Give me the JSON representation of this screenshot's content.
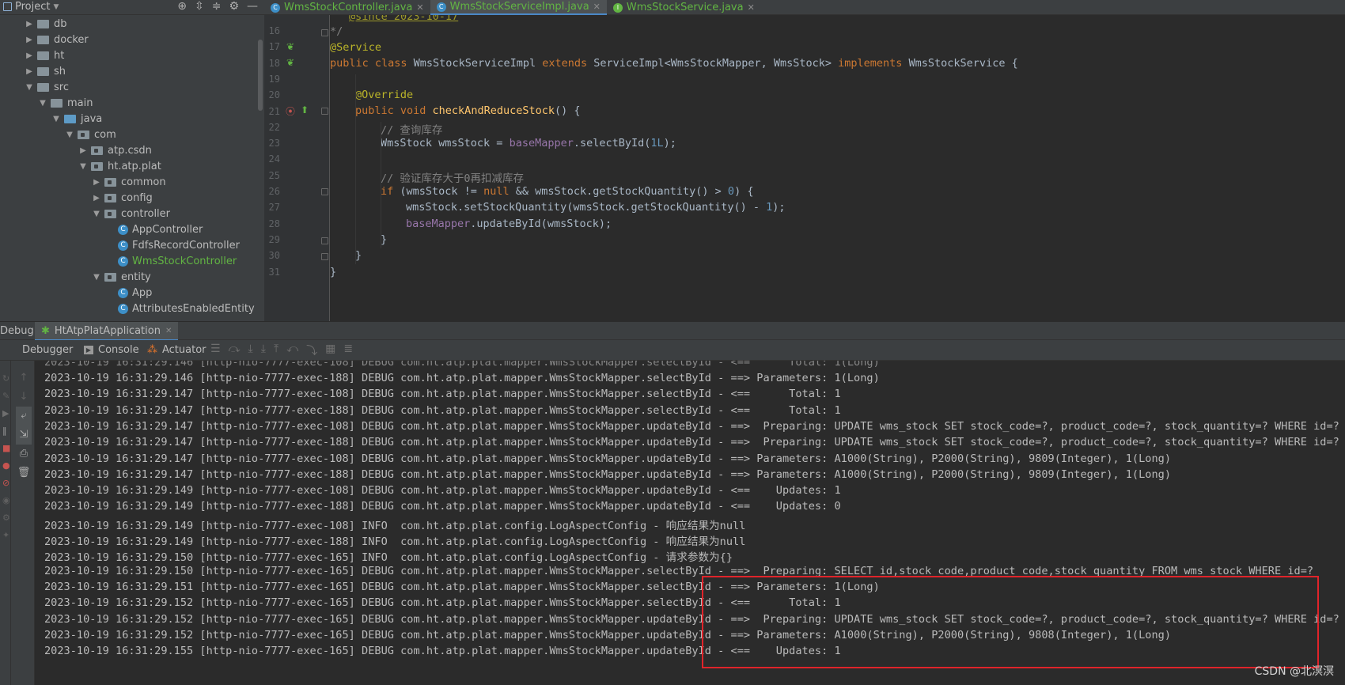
{
  "project_panel": {
    "title": "Project"
  },
  "tree": [
    {
      "label": "db",
      "depth": 1,
      "kind": "folder",
      "arrow": "right"
    },
    {
      "label": "docker",
      "depth": 1,
      "kind": "folder",
      "arrow": "right"
    },
    {
      "label": "ht",
      "depth": 1,
      "kind": "folder",
      "arrow": "right"
    },
    {
      "label": "sh",
      "depth": 1,
      "kind": "folder",
      "arrow": "right"
    },
    {
      "label": "src",
      "depth": 1,
      "kind": "folder",
      "arrow": "down"
    },
    {
      "label": "main",
      "depth": 2,
      "kind": "folder",
      "arrow": "down"
    },
    {
      "label": "java",
      "depth": 3,
      "kind": "src",
      "arrow": "down"
    },
    {
      "label": "com",
      "depth": 4,
      "kind": "pkg",
      "arrow": "down"
    },
    {
      "label": "atp.csdn",
      "depth": 5,
      "kind": "pkg",
      "arrow": "right"
    },
    {
      "label": "ht.atp.plat",
      "depth": 5,
      "kind": "pkg",
      "arrow": "down"
    },
    {
      "label": "common",
      "depth": 6,
      "kind": "pkg",
      "arrow": "right"
    },
    {
      "label": "config",
      "depth": 6,
      "kind": "pkg",
      "arrow": "right"
    },
    {
      "label": "controller",
      "depth": 6,
      "kind": "pkg",
      "arrow": "down"
    },
    {
      "label": "AppController",
      "depth": 7,
      "kind": "class",
      "arrow": ""
    },
    {
      "label": "FdfsRecordController",
      "depth": 7,
      "kind": "class",
      "arrow": ""
    },
    {
      "label": "WmsStockController",
      "depth": 7,
      "kind": "class",
      "arrow": "",
      "highlight": true
    },
    {
      "label": "entity",
      "depth": 6,
      "kind": "pkg",
      "arrow": "down"
    },
    {
      "label": "App",
      "depth": 7,
      "kind": "class",
      "arrow": ""
    },
    {
      "label": "AttributesEnabledEntity",
      "depth": 7,
      "kind": "class",
      "arrow": ""
    }
  ],
  "tabs": [
    {
      "label": "WmsStockController.java",
      "icon": "C",
      "active": false
    },
    {
      "label": "WmsStockServiceImpl.java",
      "icon": "C",
      "active": true
    },
    {
      "label": "WmsStockService.java",
      "icon": "I",
      "active": false
    }
  ],
  "editor": {
    "line_numbers": [
      "16",
      "17",
      "18",
      "19",
      "20",
      "21",
      "22",
      "23",
      "24",
      "25",
      "26",
      "27",
      "28",
      "29",
      "30",
      "31"
    ],
    "top_partial": "@since 2023-10-17"
  },
  "debug": {
    "title": "Debug:",
    "run_config": "HtAtpPlatApplication",
    "tabs": [
      "Debugger",
      "Console",
      "Actuator"
    ]
  },
  "console_lines": [
    "2023-10-19 16:31:29.146 [http-nio-7777-exec-188] DEBUG com.ht.atp.plat.mapper.WmsStockMapper.selectById - ==> Parameters: 1(Long)",
    "2023-10-19 16:31:29.147 [http-nio-7777-exec-108] DEBUG com.ht.atp.plat.mapper.WmsStockMapper.selectById - <==      Total: 1",
    "2023-10-19 16:31:29.147 [http-nio-7777-exec-188] DEBUG com.ht.atp.plat.mapper.WmsStockMapper.selectById - <==      Total: 1",
    "2023-10-19 16:31:29.147 [http-nio-7777-exec-108] DEBUG com.ht.atp.plat.mapper.WmsStockMapper.updateById - ==>  Preparing: UPDATE wms_stock SET stock_code=?, product_code=?, stock_quantity=? WHERE id=?",
    "2023-10-19 16:31:29.147 [http-nio-7777-exec-188] DEBUG com.ht.atp.plat.mapper.WmsStockMapper.updateById - ==>  Preparing: UPDATE wms_stock SET stock_code=?, product_code=?, stock_quantity=? WHERE id=?",
    "2023-10-19 16:31:29.147 [http-nio-7777-exec-108] DEBUG com.ht.atp.plat.mapper.WmsStockMapper.updateById - ==> Parameters: A1000(String), P2000(String), 9809(Integer), 1(Long)",
    "2023-10-19 16:31:29.147 [http-nio-7777-exec-188] DEBUG com.ht.atp.plat.mapper.WmsStockMapper.updateById - ==> Parameters: A1000(String), P2000(String), 9809(Integer), 1(Long)",
    "2023-10-19 16:31:29.149 [http-nio-7777-exec-108] DEBUG com.ht.atp.plat.mapper.WmsStockMapper.updateById - <==    Updates: 1",
    "2023-10-19 16:31:29.149 [http-nio-7777-exec-188] DEBUG com.ht.atp.plat.mapper.WmsStockMapper.updateById - <==    Updates: 0",
    "2023-10-19 16:31:29.149 [http-nio-7777-exec-108] INFO  com.ht.atp.plat.config.LogAspectConfig - 响应结果为null",
    "2023-10-19 16:31:29.149 [http-nio-7777-exec-188] INFO  com.ht.atp.plat.config.LogAspectConfig - 响应结果为null",
    "2023-10-19 16:31:29.150 [http-nio-7777-exec-165] INFO  com.ht.atp.plat.config.LogAspectConfig - 请求参数为{}",
    "2023-10-19 16:31:29.150 [http-nio-7777-exec-165] DEBUG com.ht.atp.plat.mapper.WmsStockMapper.selectById - ==>  Preparing: SELECT id,stock_code,product_code,stock_quantity FROM wms_stock WHERE id=?",
    "2023-10-19 16:31:29.151 [http-nio-7777-exec-165] DEBUG com.ht.atp.plat.mapper.WmsStockMapper.selectById - ==> Parameters: 1(Long)",
    "2023-10-19 16:31:29.152 [http-nio-7777-exec-165] DEBUG com.ht.atp.plat.mapper.WmsStockMapper.selectById - <==      Total: 1",
    "2023-10-19 16:31:29.152 [http-nio-7777-exec-165] DEBUG com.ht.atp.plat.mapper.WmsStockMapper.updateById - ==>  Preparing: UPDATE wms_stock SET stock_code=?, product_code=?, stock_quantity=? WHERE id=?",
    "2023-10-19 16:31:29.152 [http-nio-7777-exec-165] DEBUG com.ht.atp.plat.mapper.WmsStockMapper.updateById - ==> Parameters: A1000(String), P2000(String), 9808(Integer), 1(Long)",
    "2023-10-19 16:31:29.155 [http-nio-7777-exec-165] DEBUG com.ht.atp.plat.mapper.WmsStockMapper.updateById - <==    Updates: 1"
  ],
  "watermark": "CSDN @北溟溟",
  "colors": {
    "keyword": "#cc7832",
    "annotation": "#bbb529",
    "comment": "#808080",
    "number": "#6897bb",
    "field": "#9876aa",
    "method": "#ffc66d",
    "highlight_box": "#e0242a",
    "vcs_new": "#62b543"
  }
}
